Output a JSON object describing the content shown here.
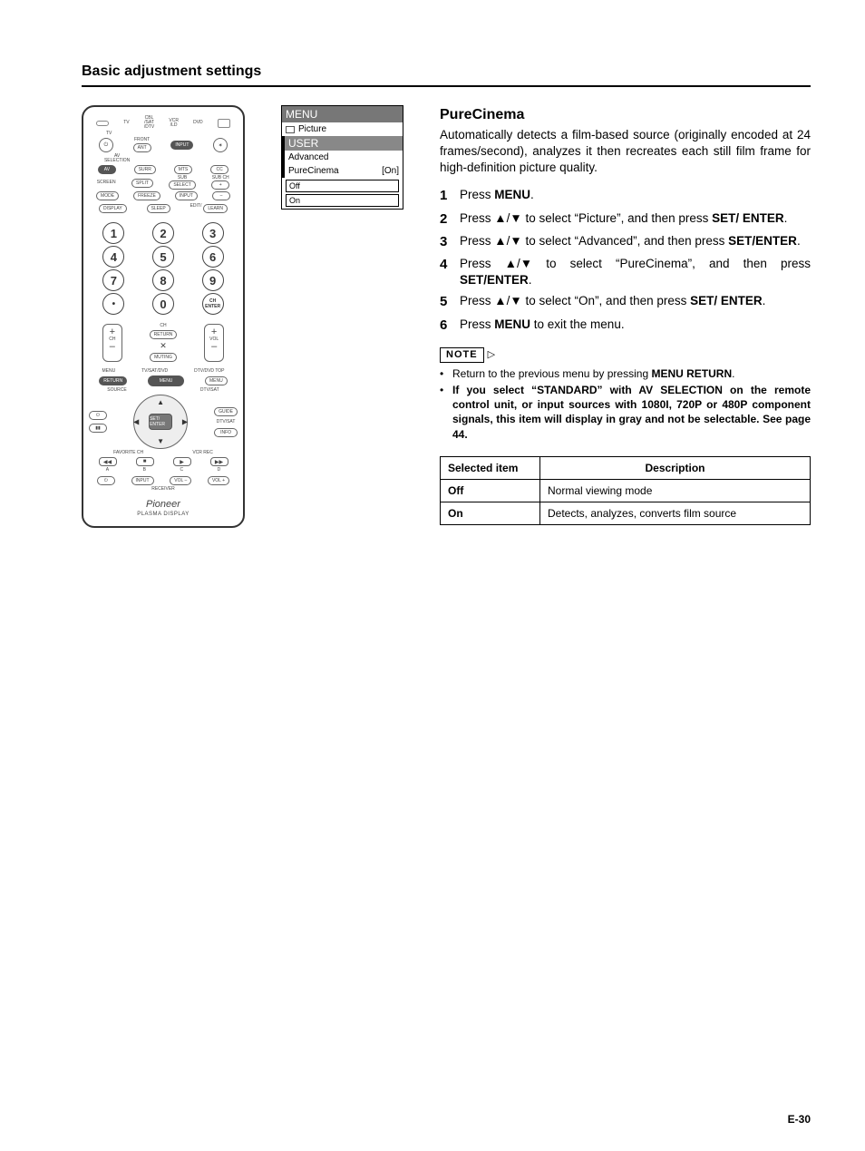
{
  "page": {
    "section_title": "Basic adjustment settings",
    "page_number": "E-30"
  },
  "osd": {
    "menu_label": "MENU",
    "picture_label": "Picture",
    "user_label": "USER",
    "advanced_label": "Advanced",
    "purecinema_label": "PureCinema",
    "purecinema_value": "[On]",
    "opt_off": "Off",
    "opt_on": "On"
  },
  "remote": {
    "top_modes": {
      "tv": "TV",
      "cbl": "CBL\n/SAT\n/DTV",
      "vcr": "VCR\n/LD",
      "dvd": "DVD"
    },
    "row_front": "FRONT",
    "btns": {
      "ant": "ANT",
      "input": "INPUT",
      "light": "✶",
      "surr": "SURR",
      "mts": "MTS",
      "cc": "CC",
      "split": "SPLIT",
      "select": "SELECT",
      "plus": "+",
      "mode": "MODE",
      "freeze": "FREEZE",
      "input2": "INPUT",
      "minus": "–",
      "display": "DISPLAY",
      "sleep": "SLEEP",
      "edit": "EDIT/",
      "learn": "LEARN",
      "dot": "•",
      "chenter": "CH\nENTER",
      "return": "RETURN",
      "muting": "MUTING",
      "menu_l": "RETURN",
      "menu_c": "MENU",
      "menu_r": "MENU",
      "guide": "GUIDE",
      "info": "INFO",
      "setenter": "SET/\nENTER",
      "vol_minus": "VOL –",
      "vol_plus": "VOL +",
      "input_rx": "INPUT"
    },
    "labels": {
      "av_selection": "AV\nSELECTION",
      "screen": "SCREEN",
      "sub": "SUB",
      "subch": "SUB CH",
      "ch": "CH",
      "vol": "VOL",
      "menu": "MENU",
      "tvsatdvd": "TV/SAT/DVD",
      "dtvdvd_top": "DTV/DVD TOP",
      "source": "SOURCE",
      "dtvsat": "DTV/SAT",
      "dtvsat2": "DTV/SAT",
      "favch": "FAVORITE CH",
      "vcrrec": "VCR REC",
      "a": "A",
      "b": "B",
      "c": "C",
      "d": "D",
      "receiver": "RECEIVER"
    },
    "numbers": [
      "1",
      "2",
      "3",
      "4",
      "5",
      "6",
      "7",
      "8",
      "9",
      "0"
    ],
    "brand": "Pioneer",
    "subbrand": "PLASMA DISPLAY"
  },
  "feature": {
    "title": "PureCinema",
    "intro": "Automatically detects a film-based source (originally encoded at 24 frames/second), analyzes it then recreates each still film frame for high-definition picture quality.",
    "steps": [
      {
        "pre": "Press ",
        "b1": "MENU",
        "post": "."
      },
      {
        "pre": "Press ",
        "arrows": true,
        "mid": " to select “Picture”, and then press ",
        "b1": "SET/ ENTER",
        "post": "."
      },
      {
        "pre": "Press ",
        "arrows": true,
        "mid": " to select “Advanced”, and then press ",
        "b1": "SET/ENTER",
        "post": "."
      },
      {
        "pre": "Press ",
        "arrows": true,
        "mid": " to select “PureCinema”, and then press ",
        "b1": "SET/ENTER",
        "post": "."
      },
      {
        "pre": "Press ",
        "arrows": true,
        "mid": " to select “On”, and then press ",
        "b1": "SET/ ENTER",
        "post": "."
      },
      {
        "pre": "Press ",
        "b1": "MENU",
        "post": " to exit the menu."
      }
    ],
    "note_label": "NOTE",
    "notes": [
      {
        "pre": "Return to the previous menu by pressing ",
        "b": "MENU RETURN",
        "post": "."
      },
      {
        "bold_all": true,
        "text": "If you select “STANDARD” with AV SELECTION on the remote control unit, or input sources with 1080I, 720P or 480P component signals, this item will display in gray and not be selectable. See page 44."
      }
    ],
    "table": {
      "h1": "Selected item",
      "h2": "Description",
      "rows": [
        {
          "item": "Off",
          "desc": "Normal viewing mode"
        },
        {
          "item": "On",
          "desc": "Detects, analyzes, converts film source"
        }
      ]
    }
  }
}
